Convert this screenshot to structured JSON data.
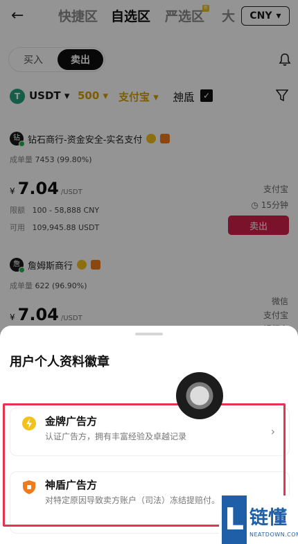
{
  "header": {
    "back": "←",
    "tabs": [
      {
        "label": "快捷区",
        "active": false
      },
      {
        "label": "自选区",
        "active": true
      },
      {
        "label": "严选区",
        "active": false
      },
      {
        "label": "大",
        "active": false
      }
    ],
    "currency": "CNY"
  },
  "toggle": {
    "buy": "买入",
    "sell": "卖出"
  },
  "filters": {
    "coin": "USDT",
    "amount": "500",
    "payment": "支付宝",
    "shield": "神盾"
  },
  "merchants": [
    {
      "name": "钻石商行-资金安全-实名支付",
      "orders_label": "成单量",
      "orders": "7453 (99.80%)",
      "currency_symbol": "¥",
      "price": "7.04",
      "price_unit": "/USDT",
      "limit_label": "限额",
      "limit": "100 - 58,888 CNY",
      "available_label": "可用",
      "available": "109,945.88 USDT",
      "payment_methods": [
        "支付宝"
      ],
      "time": "15分钟",
      "action": "卖出"
    },
    {
      "name": "詹姆斯商行",
      "orders_label": "成单量",
      "orders": "622 (96.90%)",
      "currency_symbol": "¥",
      "price": "7.04",
      "price_unit": "/USDT",
      "payment_methods": [
        "微信",
        "支付宝",
        "银行卡"
      ]
    }
  ],
  "sheet": {
    "title": "用户个人资料徽章",
    "badges": [
      {
        "title": "金牌广告方",
        "desc": "认证广告方，拥有丰富经验及卓越记录"
      },
      {
        "title": "神盾广告方",
        "desc": "对特定原因导致卖方账户（司法）冻结提赔付。"
      }
    ]
  },
  "watermark": {
    "logo": "L",
    "name": "链懂",
    "site": "NEATDOWN.COM"
  }
}
